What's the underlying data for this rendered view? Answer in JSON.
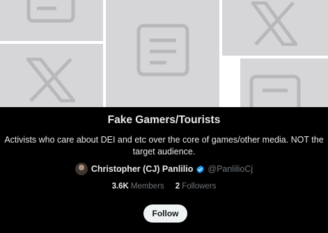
{
  "community": {
    "title": "Fake Gamers/Tourists",
    "description": "Activists who care about DEI and etc over the core of games/other media. NOT the target audience.",
    "owner": {
      "name": "Christopher (CJ) Panlilio",
      "handle": "@PanlilioCj",
      "verified_icon": "verified-badge-icon"
    },
    "stats": {
      "members_count": "3.6K",
      "members_label": "Members",
      "followers_count": "2",
      "followers_label": "Followers"
    },
    "follow_label": "Follow"
  },
  "banner": {
    "icons": [
      "document-icon",
      "x-logo-icon",
      "document-icon",
      "x-logo-icon",
      "document-icon",
      "x-logo-icon"
    ]
  },
  "colors": {
    "background": "#000000",
    "banner_tile": "#d6d6d8",
    "banner_icon": "#b8b8bb",
    "text_primary": "#e7e9ea",
    "text_secondary": "#71767b",
    "verified": "#1d9bf0",
    "button_bg": "#eff3f4",
    "button_text": "#0f1419"
  }
}
